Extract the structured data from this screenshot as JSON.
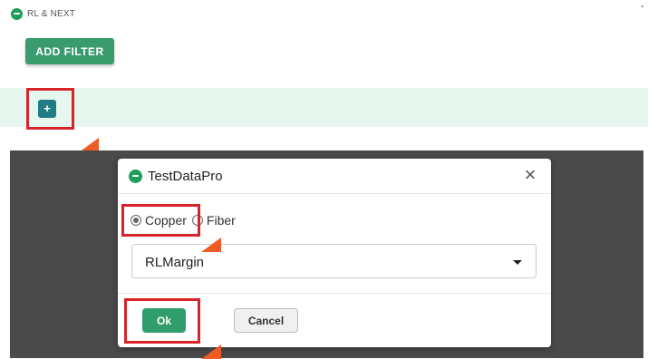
{
  "app": {
    "title": "RL & NEXT",
    "brand_color": "#1e9e5a"
  },
  "toolbar": {
    "add_filter_label": "ADD FILTER"
  },
  "filter_row": {
    "add_button_label": "+"
  },
  "dialog": {
    "title": "TestDataPro",
    "close_label": "×",
    "options": [
      {
        "label": "Copper",
        "checked": true
      },
      {
        "label": "Fiber",
        "checked": false
      }
    ],
    "select": {
      "value": "RLMargin"
    },
    "ok_label": "Ok",
    "cancel_label": "Cancel"
  },
  "annotation_colors": {
    "highlight": "#d9232a",
    "pointer": "#f05a24"
  }
}
